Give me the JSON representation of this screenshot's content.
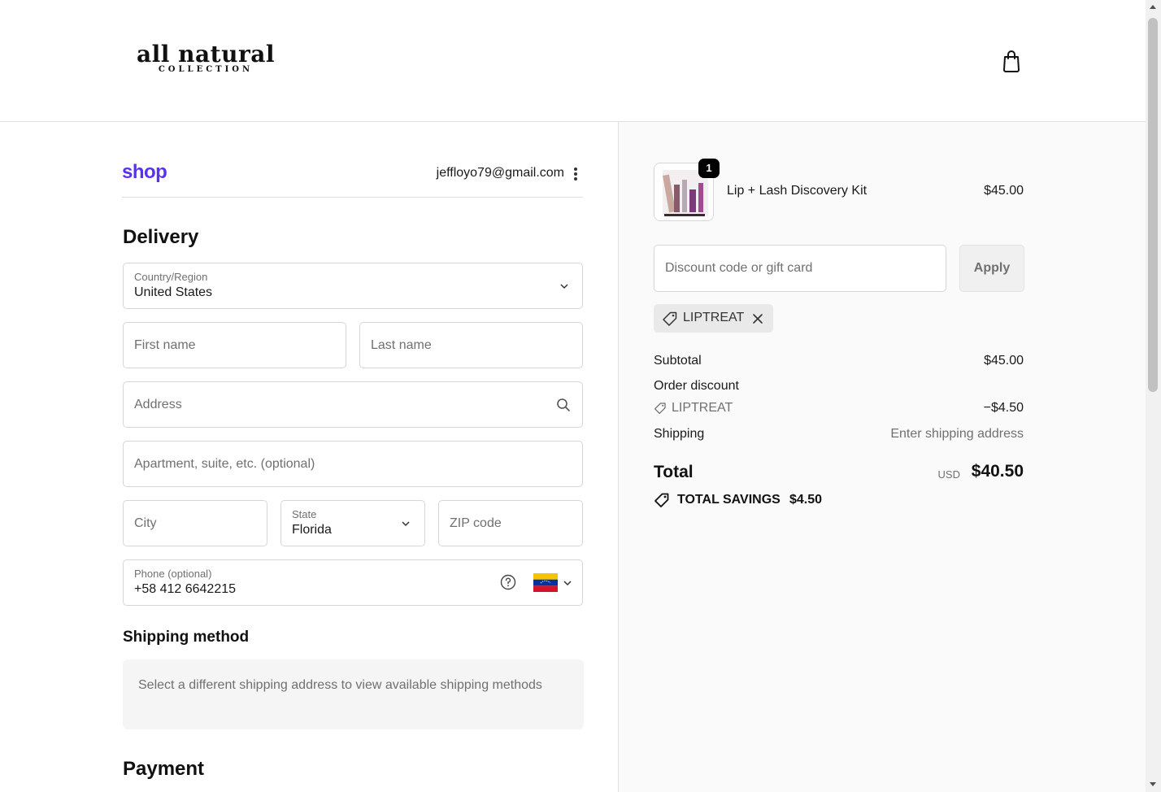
{
  "header": {
    "logo_main": "all natural",
    "logo_sub": "COLLECTION",
    "cart_icon": "shopping-bag-icon"
  },
  "account": {
    "shop_brand": "shop",
    "email": "jeffloyo79@gmail.com",
    "menu_icon": "more-vertical-icon"
  },
  "delivery": {
    "heading": "Delivery",
    "country": {
      "label": "Country/Region",
      "value": "United States"
    },
    "first_name_placeholder": "First name",
    "last_name_placeholder": "Last name",
    "address_placeholder": "Address",
    "apartment_placeholder": "Apartment, suite, etc. (optional)",
    "city_placeholder": "City",
    "state": {
      "label": "State",
      "value": "Florida"
    },
    "zip_placeholder": "ZIP code",
    "phone": {
      "label": "Phone (optional)",
      "value": "+58 412 6642215",
      "help_icon": "question-circle-icon",
      "flag_icon": "venezuela-flag-icon"
    }
  },
  "shipping_method": {
    "heading": "Shipping method",
    "note": "Select a different shipping address to view available shipping methods"
  },
  "payment": {
    "heading": "Payment"
  },
  "order": {
    "item": {
      "name": "Lip + Lash Discovery Kit",
      "price": "$45.00",
      "quantity": "1"
    },
    "discount_placeholder": "Discount code or gift card",
    "apply_label": "Apply",
    "applied_code": "LIPTREAT",
    "subtotal_label": "Subtotal",
    "subtotal_value": "$45.00",
    "order_discount_label": "Order discount",
    "discount_code": "LIPTREAT",
    "discount_value": "−$4.50",
    "shipping_label": "Shipping",
    "shipping_value": "Enter shipping address",
    "total_label": "Total",
    "currency": "USD",
    "total_value": "$40.50",
    "savings_label": "TOTAL SAVINGS",
    "savings_value": "$4.50"
  },
  "colors": {
    "shop_brand": "#5a31f4",
    "summary_bg": "#fafafa",
    "border": "#d6d6d6"
  }
}
